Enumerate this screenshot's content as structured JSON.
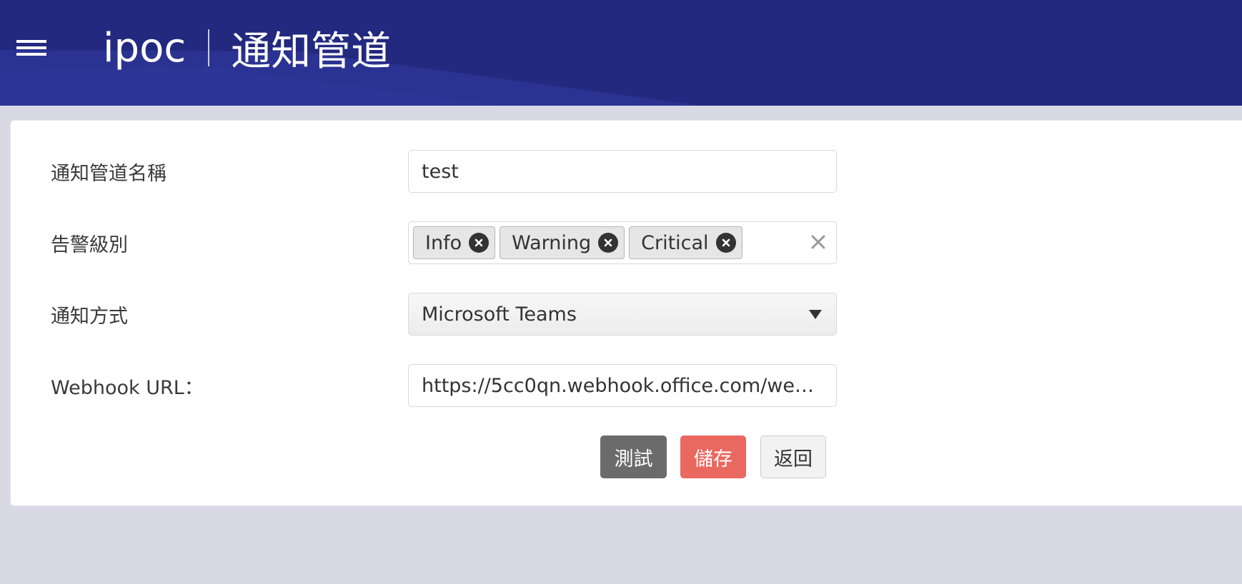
{
  "header": {
    "brand": "ipoc",
    "page_title": "通知管道"
  },
  "form": {
    "name_label": "通知管道名稱",
    "name_value": "test",
    "severity_label": "告警級別",
    "severity_tags": [
      "Info",
      "Warning",
      "Critical"
    ],
    "method_label": "通知方式",
    "method_value": "Microsoft Teams",
    "webhook_label": "Webhook URL：",
    "webhook_value": "https://5cc0qn.webhook.office.com/webho…"
  },
  "actions": {
    "test_label": "測試",
    "save_label": "儲存",
    "back_label": "返回"
  },
  "colors": {
    "header_bg": "#22297f",
    "page_bg": "#d8d9e5",
    "test_button": "#6b6b6b",
    "save_button": "#e9685f"
  },
  "icons": {
    "menu": "hamburger-menu-icon",
    "tag_remove": "circle-x-icon",
    "clear_all": "close-icon",
    "dropdown": "caret-down-icon"
  }
}
